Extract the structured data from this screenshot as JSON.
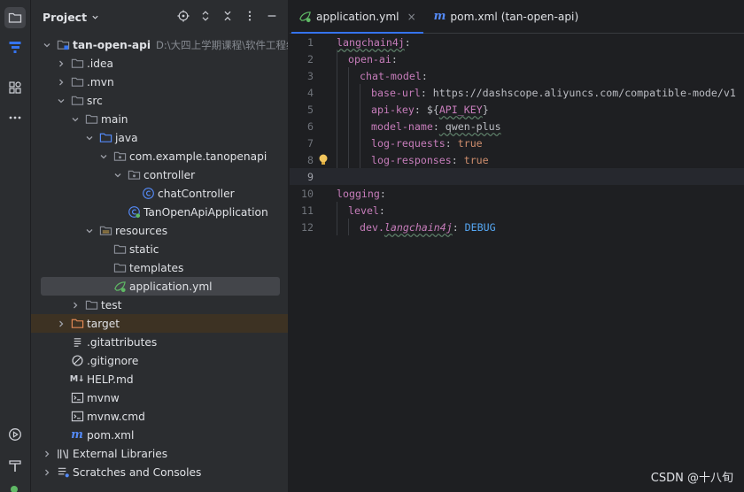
{
  "panel": {
    "title": "Project"
  },
  "tree": [
    {
      "label": "tan-open-api",
      "path": "D:\\大四上学期课程\\软件工程综合",
      "bold": true
    },
    {
      "label": ".idea"
    },
    {
      "label": ".mvn"
    },
    {
      "label": "src"
    },
    {
      "label": "main"
    },
    {
      "label": "java"
    },
    {
      "label": "com.example.tanopenapi"
    },
    {
      "label": "controller"
    },
    {
      "label": "chatController"
    },
    {
      "label": "TanOpenApiApplication"
    },
    {
      "label": "resources"
    },
    {
      "label": "static"
    },
    {
      "label": "templates"
    },
    {
      "label": "application.yml"
    },
    {
      "label": "test"
    },
    {
      "label": "target"
    },
    {
      "label": ".gitattributes"
    },
    {
      "label": ".gitignore"
    },
    {
      "label": "HELP.md"
    },
    {
      "label": "mvnw"
    },
    {
      "label": "mvnw.cmd"
    },
    {
      "label": "pom.xml"
    },
    {
      "label": "External Libraries"
    },
    {
      "label": "Scratches and Consoles"
    }
  ],
  "icons": {
    "md_badge": "M↓",
    "maven_badge": "m"
  },
  "tabs": [
    {
      "label": "application.yml",
      "close": "×"
    },
    {
      "label": "pom.xml (tan-open-api)"
    }
  ],
  "code": {
    "line_numbers": [
      "1",
      "2",
      "3",
      "4",
      "5",
      "6",
      "7",
      "8",
      "9",
      "10",
      "11",
      "12"
    ],
    "l1_key": "langchain4j",
    "colon": ":",
    "l2_key": "open-ai",
    "l3_key": "chat-model",
    "l4_key": "base-url",
    "l4_val": " https://dashscope.aliyuncs.com/compatible-mode/v1",
    "l5_key": "api-key",
    "l5_pre": " ${",
    "l5_ph": "API_KEY",
    "l5_post": "}",
    "l6_key": "model-name",
    "l6_val": " qwen-plus",
    "l7_key": "log-requests",
    "l7_val": "true",
    "l8_key": "log-responses",
    "l8_val": "true",
    "l10_key": "logging",
    "l11_key": "level",
    "l12_key_a": "dev.",
    "l12_key_b": "langchain4j",
    "l12_val": "DEBUG"
  },
  "watermark": "CSDN @十八旬",
  "colors": {
    "accent": "#3574f0",
    "key": "#c77dbb",
    "bool": "#cf8e6d",
    "folder": "#8c9099"
  }
}
